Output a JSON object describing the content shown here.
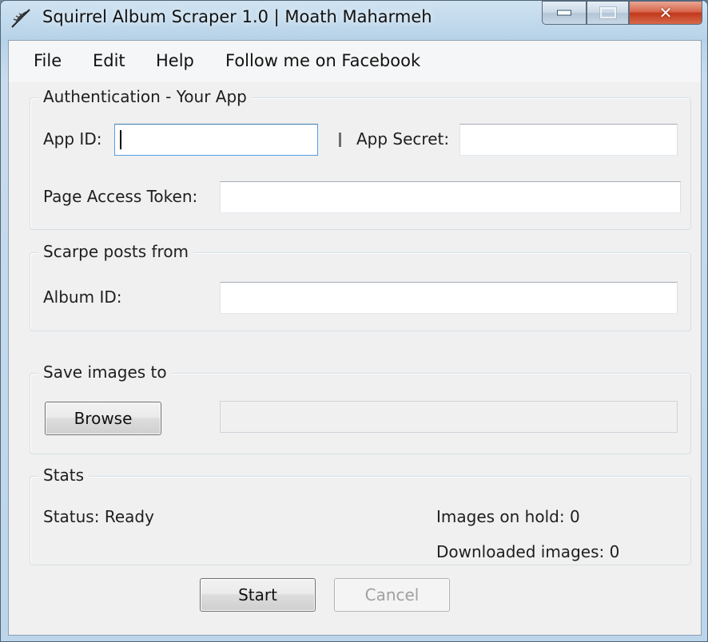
{
  "window": {
    "title": "Squirrel Album Scraper 1.0 | Moath Maharmeh",
    "icon": "squirrel-feather-icon",
    "controls": {
      "minimize": "minimize-icon",
      "maximize": "maximize-icon",
      "close": "✕"
    }
  },
  "menu": {
    "items": [
      "File",
      "Edit",
      "Help",
      "Follow me on Facebook"
    ]
  },
  "auth": {
    "title": "Authentication - Your App",
    "app_id_label": "App ID:",
    "app_id_value": "",
    "separator": "|",
    "app_secret_label": "App Secret:",
    "app_secret_value": "",
    "token_label": "Page Access Token:",
    "token_value": ""
  },
  "scrape": {
    "title": "Scarpe posts from",
    "album_label": "Album ID:",
    "album_value": ""
  },
  "save": {
    "title": "Save images to",
    "browse_label": "Browse",
    "path_value": ""
  },
  "stats": {
    "title": "Stats",
    "status": "Status: Ready",
    "on_hold": "Images on hold: 0",
    "downloaded": "Downloaded images: 0"
  },
  "actions": {
    "start_label": "Start",
    "cancel_label": "Cancel"
  }
}
